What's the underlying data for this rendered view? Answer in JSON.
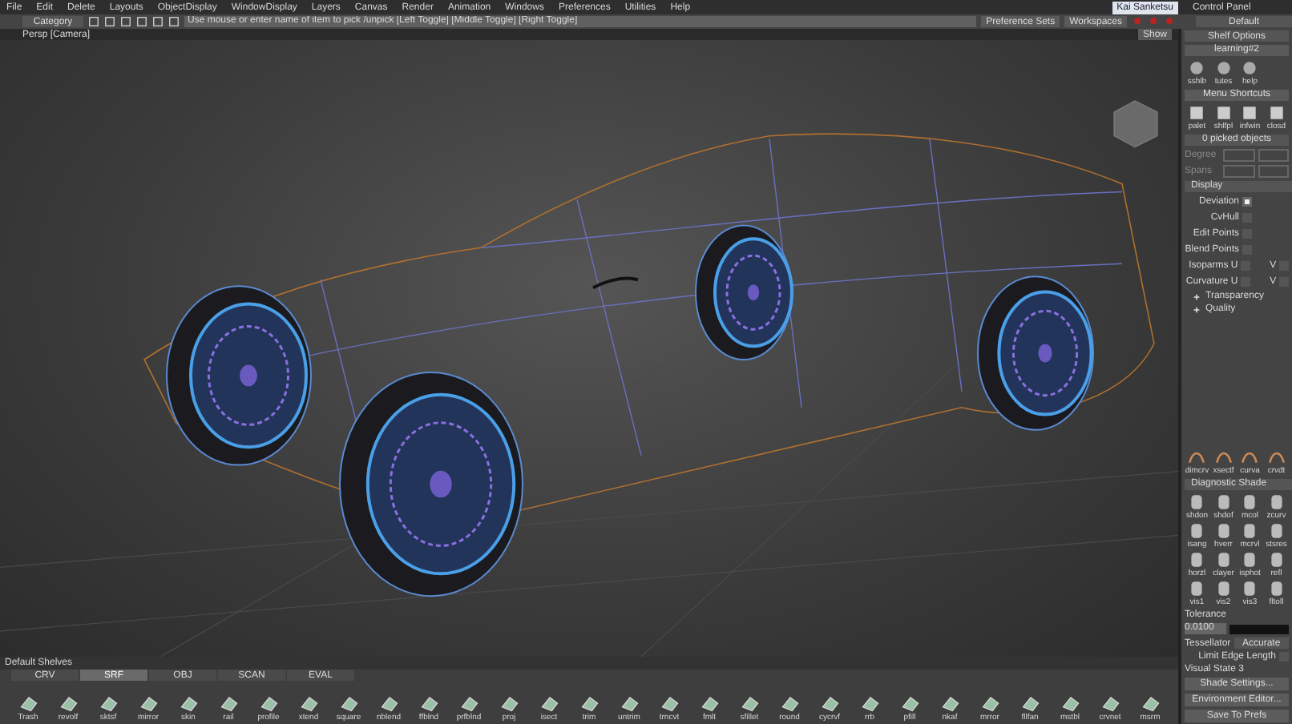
{
  "menu_bar": [
    "File",
    "Edit",
    "Delete",
    "Layouts",
    "ObjectDisplay",
    "WindowDisplay",
    "Layers",
    "Canvas",
    "Render",
    "Animation",
    "Windows",
    "Preferences",
    "Utilities",
    "Help"
  ],
  "toolbar": {
    "category": "Category",
    "prompt": "Use mouse or enter name of item to pick /unpick [Left Toggle] [Middle Toggle] [Right Toggle]",
    "preference_sets": "Preference Sets",
    "workspaces": "Workspaces"
  },
  "user": {
    "name": "Kai Sanketsu"
  },
  "viewport": {
    "title": "Persp [Camera]",
    "show_button": "Show"
  },
  "control_panel": {
    "title": "Control Panel",
    "preset": "Default",
    "shelf_options": "Shelf Options",
    "shelf_tab": "learning#2",
    "tools": [
      "sshlb",
      "tutes",
      "help"
    ],
    "menu_shortcuts": "Menu Shortcuts",
    "shortcuts": [
      "palet",
      "shlfpl",
      "infwin",
      "closd"
    ],
    "picked": "0 picked objects",
    "degree": "Degree",
    "spans": "Spans",
    "display": {
      "title": "Display",
      "options": [
        {
          "label": "Deviation",
          "checked": true
        },
        {
          "label": "CvHull",
          "checked": false
        },
        {
          "label": "Edit Points",
          "checked": false
        },
        {
          "label": "Blend Points",
          "checked": false
        },
        {
          "label": "Isoparms U",
          "checked": false,
          "extra": {
            "label": "V",
            "checked": false
          }
        },
        {
          "label": "Curvature U",
          "checked": false,
          "extra": {
            "label": "V",
            "checked": false
          }
        }
      ]
    },
    "sections": [
      "Transparency",
      "Quality"
    ],
    "eval_tools": [
      "dimcrv",
      "xsectf",
      "curva",
      "crvdt"
    ],
    "diagnostic_shade": {
      "title": "Diagnostic Shade",
      "tools": [
        "shdon",
        "shdof",
        "mcol",
        "zcurv",
        "isang",
        "hverr",
        "mcrvl",
        "stsres",
        "horzl",
        "clayer",
        "isphot",
        "refl",
        "vis1",
        "vis2",
        "vis3",
        "fltoll"
      ]
    },
    "tolerance": {
      "label": "Tolerance",
      "value": "0.0100"
    },
    "tessellator": {
      "label": "Tessellator",
      "value": "Accurate"
    },
    "limit_edge_length": {
      "label": "Limit Edge Length",
      "checked": false
    },
    "visual_state": "Visual State 3",
    "buttons": [
      "Shade Settings...",
      "Environment Editor...",
      "Save To Prefs"
    ]
  },
  "shelves": {
    "title": "Default Shelves",
    "tabs": [
      {
        "label": "CRV",
        "selected": false
      },
      {
        "label": "SRF",
        "selected": true
      },
      {
        "label": "OBJ",
        "selected": false
      },
      {
        "label": "SCAN",
        "selected": false
      },
      {
        "label": "EVAL",
        "selected": false
      }
    ],
    "tools": [
      "Trash",
      "revolf",
      "sktsf",
      "mirror",
      "skin",
      "rail",
      "profile",
      "xtend",
      "square",
      "nblend",
      "ffblnd",
      "prfblnd",
      "proj",
      "isect",
      "trim",
      "untrim",
      "trncvt",
      "fmlt",
      "sfillet",
      "round",
      "cycrvf",
      "rrb",
      "pfill",
      "nkaf",
      "mrror",
      "fllfan",
      "mstbl",
      "crvnet",
      "msrm"
    ]
  }
}
